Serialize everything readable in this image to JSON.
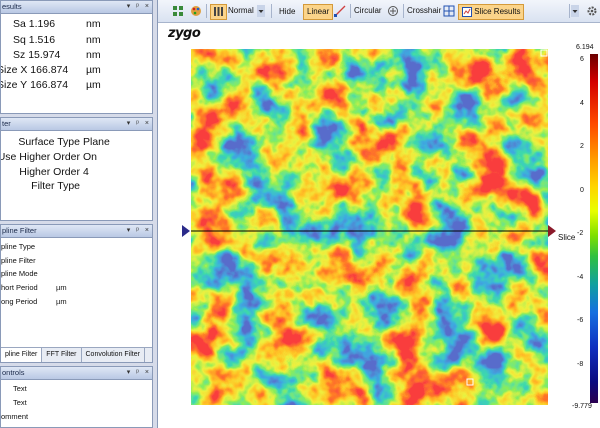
{
  "results_panel": {
    "title": "esults",
    "rows": [
      {
        "label": "Sa",
        "value": "1.196",
        "unit": "nm"
      },
      {
        "label": "Sq",
        "value": "1.516",
        "unit": "nm"
      },
      {
        "label": "Sz",
        "value": "15.974",
        "unit": "nm"
      },
      {
        "label": "Size X",
        "value": "166.874",
        "unit": "µm"
      },
      {
        "label": "Size Y",
        "value": "166.874",
        "unit": "µm"
      }
    ]
  },
  "filter_panel": {
    "title": "ter",
    "rows": [
      {
        "label": "Surface Type",
        "value": "Plane"
      },
      {
        "label": "Use Higher Order",
        "value": "On"
      },
      {
        "label": "Higher Order",
        "value": "4"
      },
      {
        "label": "Filter Type",
        "value": ""
      }
    ]
  },
  "spline_panel": {
    "title": "pline Filter",
    "rows": [
      {
        "label": "pline Type",
        "value": ""
      },
      {
        "label": "pline Filter",
        "value": ""
      },
      {
        "label": "pline Mode",
        "value": ""
      },
      {
        "label": "hort Period",
        "value": "µm"
      },
      {
        "label": "ong Period",
        "value": "µm"
      }
    ],
    "tabs": [
      "pline Filter",
      "FFT Filter",
      "Convolution Filter"
    ]
  },
  "controls_panel": {
    "title": "ontrols",
    "rows": [
      {
        "label": "",
        "value": "Text"
      },
      {
        "label": "",
        "value": "Text"
      },
      {
        "label": "omment",
        "value": ""
      }
    ]
  },
  "panel_buttons": {
    "dropdown": "▾",
    "pin": "ᵖ",
    "close": "×"
  },
  "toolbar": {
    "normal_label": "Normal",
    "hide_label": "Hide",
    "linear_label": "Linear",
    "circular_label": "Circular",
    "crosshair_label": "Crosshair",
    "slice_results_label": "Slice Results"
  },
  "plot": {
    "logo": "zygo",
    "slice_label": "Slice",
    "colorbar_max": "6.194",
    "colorbar_min": "-9.779",
    "colorbar_ticks": [
      "6",
      "4",
      "2",
      "0",
      "-2",
      "-4",
      "-6",
      "-8"
    ],
    "colors": {
      "accent_marker": "#2b2b8a",
      "slice_line": "#000000"
    }
  }
}
